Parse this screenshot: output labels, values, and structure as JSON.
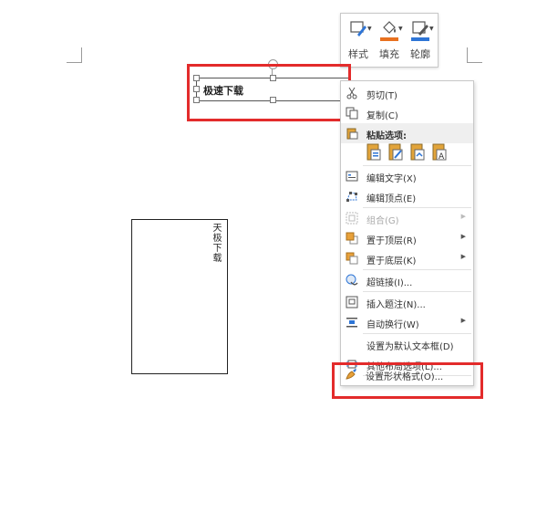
{
  "mini_toolbar": {
    "buttons": [
      {
        "label": "样式",
        "icon": "shape-style-icon"
      },
      {
        "label": "填充",
        "icon": "fill-bucket-icon",
        "color": "#e8711f"
      },
      {
        "label": "轮廓",
        "icon": "outline-pen-icon",
        "color": "#2e75d6"
      }
    ]
  },
  "textbox": {
    "text": "极速下载"
  },
  "vertical_textbox": {
    "text": "天极下载"
  },
  "context_menu": {
    "cut": "剪切(T)",
    "copy": "复制(C)",
    "paste_options_header": "粘贴选项:",
    "edit_text": "编辑文字(X)",
    "edit_points": "编辑顶点(E)",
    "group": "组合(G)",
    "bring_to_front": "置于顶层(R)",
    "send_to_back": "置于底层(K)",
    "hyperlink": "超链接(I)...",
    "insert_caption": "插入题注(N)...",
    "wrap_text": "自动换行(W)",
    "set_default_textbox": "设置为默认文本框(D)",
    "more_layout_options": "其他布局选项(L)...",
    "format_shape": "设置形状格式(O)..."
  },
  "colors": {
    "highlight": "#e32b2b",
    "fill": "#e8711f",
    "outline": "#2e75d6"
  }
}
